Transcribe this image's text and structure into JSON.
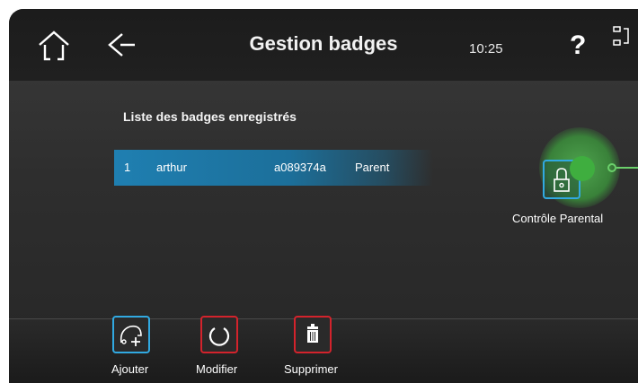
{
  "header": {
    "title": "Gestion badges",
    "time": "10:25",
    "help": "?",
    "icons": {
      "home": "home-icon",
      "back": "back-arrow-icon",
      "window": "window-toggle-icon"
    }
  },
  "badges": {
    "section_title": "Liste des badges enregistrés",
    "rows": [
      {
        "index": "1",
        "name": "arthur",
        "id": "a089374a",
        "role": "Parent"
      }
    ]
  },
  "parental_control": {
    "label": "Contrôle Parental",
    "icon": "lock-icon"
  },
  "toolbar": {
    "add_label": "Ajouter",
    "edit_label": "Modifier",
    "delete_label": "Supprimer",
    "icons": {
      "add": "add-badge-icon",
      "edit": "refresh-icon",
      "delete": "trash-icon"
    }
  },
  "colors": {
    "accent_blue": "#31a9e1",
    "danger_red": "#d3232c",
    "selection_blue": "#1f7fb1",
    "parental_green": "#3fae3f"
  }
}
